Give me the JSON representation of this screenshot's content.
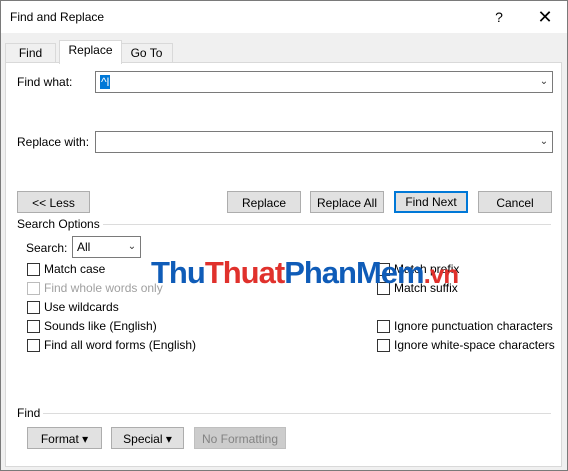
{
  "window": {
    "title": "Find and Replace",
    "help": "?",
    "close": "✕"
  },
  "tabs": [
    {
      "label": "Find"
    },
    {
      "label": "Replace"
    },
    {
      "label": "Go To"
    }
  ],
  "find": {
    "label": "Find what:",
    "value": "^l"
  },
  "replace": {
    "label": "Replace with:",
    "value": ""
  },
  "buttons": {
    "less": "<< Less",
    "replace": "Replace",
    "replace_all": "Replace All",
    "find_next": "Find Next",
    "cancel": "Cancel"
  },
  "search_options": {
    "heading": "Search Options",
    "search_label": "Search:",
    "search_value": "All"
  },
  "options_left": [
    {
      "label": "Match case",
      "checked": false,
      "enabled": true
    },
    {
      "label": "Find whole words only",
      "checked": false,
      "enabled": false
    },
    {
      "label": "Use wildcards",
      "checked": false,
      "enabled": true
    },
    {
      "label": "Sounds like (English)",
      "checked": false,
      "enabled": true
    },
    {
      "label": "Find all word forms (English)",
      "checked": false,
      "enabled": true
    }
  ],
  "options_right": [
    {
      "label": "Match prefix",
      "checked": false,
      "enabled": true
    },
    {
      "label": "Match suffix",
      "checked": false,
      "enabled": true
    },
    {
      "label": "Ignore punctuation characters",
      "checked": false,
      "enabled": true
    },
    {
      "label": "Ignore white-space characters",
      "checked": false,
      "enabled": true
    }
  ],
  "find_section": {
    "heading": "Find",
    "format": "Format ▾",
    "special": "Special ▾",
    "no_formatting": "No Formatting"
  },
  "watermark": {
    "part1": "Thu",
    "part2": "Thuat",
    "part3": "PhanMem",
    "part4": ".vn"
  },
  "colors": {
    "accent": "#0078d7",
    "watermark_blue": "#0f5cb8",
    "watermark_red": "#e0312c"
  }
}
